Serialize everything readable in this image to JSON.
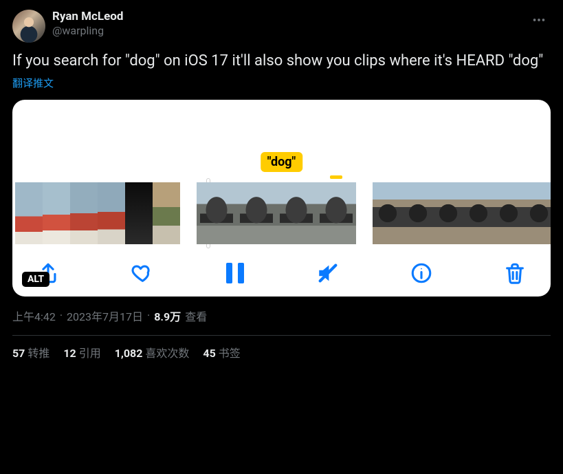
{
  "author": {
    "display_name": "Ryan McLeod",
    "handle": "@warpling"
  },
  "tweet_text": "If you search for \"dog\" on iOS 17 it'll also show you clips where it's HEARD \"dog\"",
  "translate_label": "翻译推文",
  "media": {
    "caption_chip": "\"dog\"",
    "alt_badge": "ALT",
    "toolbar_icons": {
      "share": "share-icon",
      "like": "heart-icon",
      "pause": "pause-icon",
      "mute": "mute-icon",
      "info": "info-icon",
      "delete": "trash-icon"
    }
  },
  "meta": {
    "time": "上午4:42",
    "separator": " · ",
    "date": "2023年7月17日",
    "views_count": "8.9万",
    "views_label": " 查看"
  },
  "stats": {
    "retweets": {
      "count": "57",
      "label": "转推"
    },
    "quotes": {
      "count": "12",
      "label": "引用"
    },
    "likes": {
      "count": "1,082",
      "label": "喜欢次数"
    },
    "bookmarks": {
      "count": "45",
      "label": "书签"
    }
  }
}
